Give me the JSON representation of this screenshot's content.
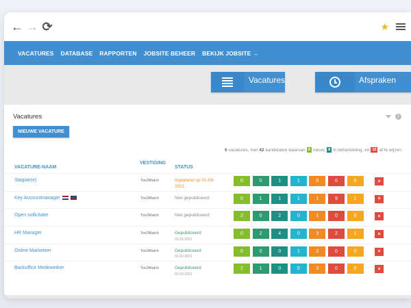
{
  "colors": {
    "primary": "#3f8fd2",
    "green": "#86bd2e",
    "dark_green": "#2e9a72",
    "teal": "#1f8f86",
    "cyan": "#23b5d0",
    "orange": "#f08a24",
    "red": "#e04b3f",
    "amber": "#f5a623",
    "status_orange": "#f08a24",
    "status_gray": "#888888",
    "status_green": "#3a9b6b"
  },
  "browser": {
    "back_icon": "arrow-left-icon",
    "forward_icon": "arrow-right-icon",
    "reload_icon": "reload-icon",
    "star_icon": "star-icon",
    "menu_icon": "hamburger-icon"
  },
  "nav": {
    "items": [
      {
        "label": "VACATURES"
      },
      {
        "label": "DATABASE"
      },
      {
        "label": "RAPPORTEN"
      },
      {
        "label": "JOBSITE BEHEER"
      },
      {
        "label": "BEKIJK JOBSITE →"
      }
    ]
  },
  "quick": {
    "vacatures": {
      "label": "Vacatures",
      "icon": "list-icon"
    },
    "afspraken": {
      "label": "Afspraken",
      "icon": "clock-icon"
    }
  },
  "card": {
    "title": "Vacatures",
    "new_button": "NIEUWE VACATURE",
    "summary": {
      "vac_count": "6",
      "t1": "vacatures, met",
      "cand_count": "42",
      "t2": "kandidaten waarvan",
      "new_count": "4",
      "t3": "nieuw,",
      "proc_count": "8",
      "t4": "in behandeling, en",
      "todo_count": "10",
      "t5": "af te wijzen"
    },
    "headers": {
      "name": "VACATURE-NAAM",
      "location": "VESTIGING",
      "status": "STATUS"
    }
  },
  "count_colors": [
    "#86bd2e",
    "#2e9a72",
    "#1f8f86",
    "#23b5d0",
    "#f08a24",
    "#e04b3f",
    "#f5a623"
  ],
  "rows": [
    {
      "name": "Stagiair(e)",
      "flags": [],
      "location": "Too2Match",
      "status": "Ingepland op 01-09-2021",
      "status_sub": "",
      "status_color": "#f08a24",
      "counts": [
        "0",
        "0",
        "1",
        "1",
        "0",
        "0",
        "0"
      ]
    },
    {
      "name": "Key Accountmanager",
      "flags": [
        "nl",
        "gb"
      ],
      "location": "Too2Match",
      "status": "Niet gepubliceerd",
      "status_sub": "",
      "status_color": "#888888",
      "counts": [
        "0",
        "1",
        "1",
        "1",
        "1",
        "9",
        "1"
      ]
    },
    {
      "name": "Open sollicitatie",
      "flags": [],
      "location": "Too2Match",
      "status": "Niet gepubliceerd",
      "status_sub": "",
      "status_color": "#888888",
      "counts": [
        "2",
        "0",
        "2",
        "0",
        "1",
        "0",
        "0"
      ]
    },
    {
      "name": "HR Manager",
      "flags": [],
      "location": "Too2Match",
      "status": "Gepubliceerd",
      "status_sub": "01-01-2021",
      "status_color": "#3a9b6b",
      "counts": [
        "0",
        "2",
        "4",
        "0",
        "3",
        "2",
        "1"
      ]
    },
    {
      "name": "Online Marketeer",
      "flags": [],
      "location": "Too2Match",
      "status": "Gepubliceerd",
      "status_sub": "01-02-2021",
      "status_color": "#3a9b6b",
      "counts": [
        "0",
        "0",
        "0",
        "1",
        "2",
        "0",
        "0"
      ]
    },
    {
      "name": "Backoffice Medewerker",
      "flags": [],
      "location": "Too2Match",
      "status": "Gepubliceerd",
      "status_sub": "01-03-2021",
      "status_color": "#3a9b6b",
      "counts": [
        "2",
        "1",
        "0",
        "0",
        "3",
        "0",
        "0"
      ]
    }
  ],
  "delete_glyph": "×"
}
